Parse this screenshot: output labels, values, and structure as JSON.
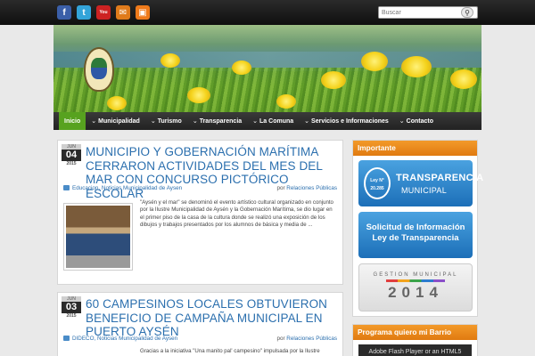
{
  "social": {
    "facebook": "f",
    "twitter": "t",
    "youtube": "You",
    "email": "✉",
    "rss": "▣"
  },
  "search": {
    "placeholder": "Buscar",
    "button": "⚲"
  },
  "nav": {
    "items": [
      {
        "label": "Inicio",
        "active": true,
        "dropdown": false
      },
      {
        "label": "Municipalidad",
        "active": false,
        "dropdown": true
      },
      {
        "label": "Turismo",
        "active": false,
        "dropdown": true
      },
      {
        "label": "Transparencia",
        "active": false,
        "dropdown": true
      },
      {
        "label": "La Comuna",
        "active": false,
        "dropdown": true
      },
      {
        "label": "Servicios e Informaciones",
        "active": false,
        "dropdown": true
      },
      {
        "label": "Contacto",
        "active": false,
        "dropdown": true
      }
    ],
    "chevron": "⌄"
  },
  "posts": [
    {
      "date": {
        "month": "JUN",
        "day": "04",
        "year": "2015"
      },
      "title": "Municipio y Gobernación Marítima cerraron actividades del mes del mar con concurso pictórico escolar",
      "categories": "Educacion, Noticias Municipalidad de Aysen",
      "author_prefix": "por",
      "author": "Relaciones Públicas",
      "excerpt": "\"Aysén y el mar\" se denominó el evento artístico cultural organizado en conjunto por la Ilustre Municipalidad de Aysén y la Gobernación Marítima, se dio lugar en el primer piso de la casa de la cultura donde se realizó una exposición de los dibujos y trabajos presentados por los alumnos de básica y media de ..."
    },
    {
      "date": {
        "month": "JUN",
        "day": "03",
        "year": "2015"
      },
      "title": "60 campesinos locales obtuvieron beneficio de campaña municipal en Puerto Aysén",
      "categories": "DIDECO, Noticias Municipalidad de Aysen",
      "author_prefix": "por",
      "author": "Relaciones Públicas",
      "excerpt": "Gracias a la iniciativa \"Una manito pal' campesino\" impulsada por la Ilustre"
    }
  ],
  "sidebar": {
    "widget1": {
      "title": "Importante",
      "banner1": {
        "badge": "Ley N° 20.285",
        "line1": "TRANSPARENCIA",
        "line2": "MUNICIPAL"
      },
      "banner2": {
        "line1": "Solicitud de Información",
        "line2": "Ley de Transparencia"
      },
      "banner3": {
        "line1": "GESTION MUNICIPAL",
        "year": "2014"
      }
    },
    "widget2": {
      "title": "Programa quiero mi Barrio",
      "content": "Adobe Flash Player or an HTML5"
    }
  },
  "colors": {
    "accent_orange": "#e07a10",
    "nav_active": "#57a21f",
    "link_blue": "#2b6fae"
  }
}
